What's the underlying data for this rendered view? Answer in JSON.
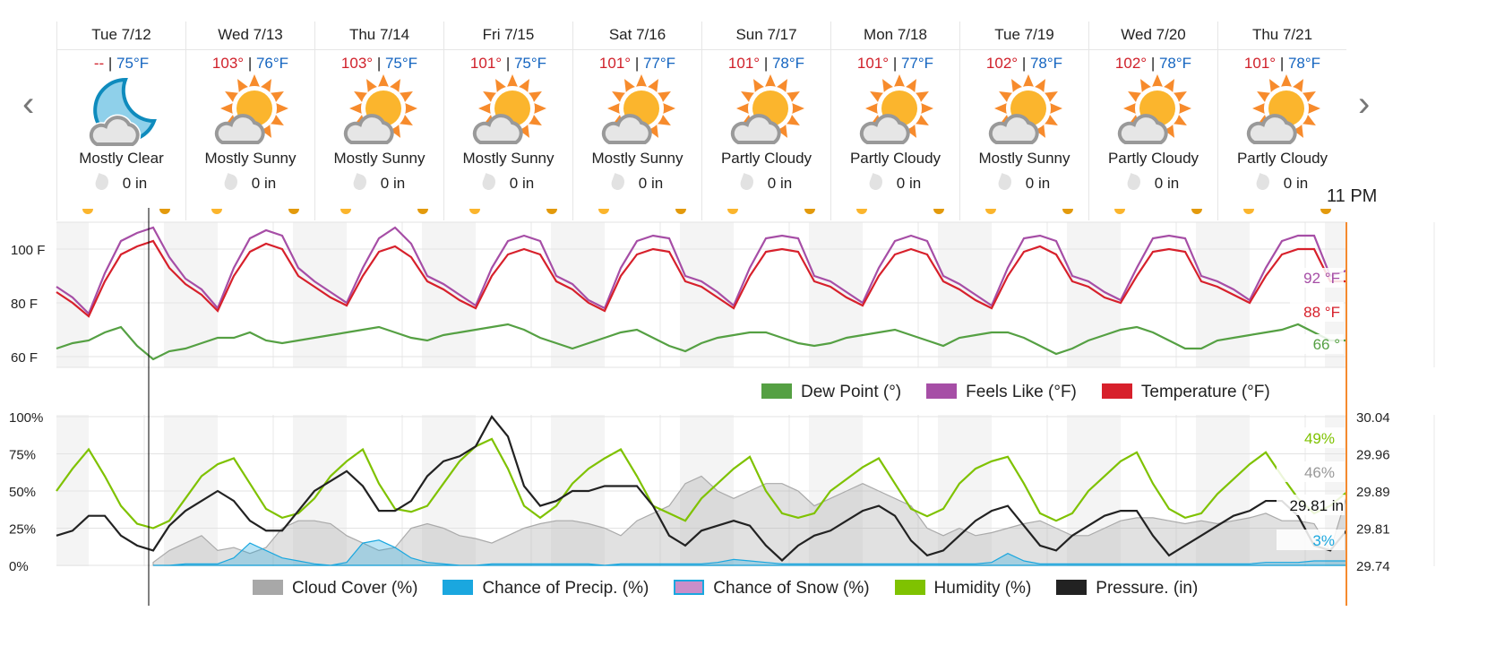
{
  "nav": {
    "prev_icon": "chevron-left-icon",
    "next_icon": "chevron-right-icon",
    "prev": "‹",
    "next": "›"
  },
  "current_time_label": "11 PM",
  "days": [
    {
      "date": "Tue 7/12",
      "high": "--",
      "low": "75°F",
      "icon": "moon-cloud-icon",
      "condition": "Mostly Clear",
      "precip": "0 in"
    },
    {
      "date": "Wed 7/13",
      "high": "103°",
      "low": "76°F",
      "icon": "sun-cloud-icon",
      "condition": "Mostly Sunny",
      "precip": "0 in"
    },
    {
      "date": "Thu 7/14",
      "high": "103°",
      "low": "75°F",
      "icon": "sun-cloud-icon",
      "condition": "Mostly Sunny",
      "precip": "0 in"
    },
    {
      "date": "Fri 7/15",
      "high": "101°",
      "low": "75°F",
      "icon": "sun-cloud-icon",
      "condition": "Mostly Sunny",
      "precip": "0 in"
    },
    {
      "date": "Sat 7/16",
      "high": "101°",
      "low": "77°F",
      "icon": "sun-cloud-icon",
      "condition": "Mostly Sunny",
      "precip": "0 in"
    },
    {
      "date": "Sun 7/17",
      "high": "101°",
      "low": "78°F",
      "icon": "sun-cloud-icon",
      "condition": "Partly Cloudy",
      "precip": "0 in"
    },
    {
      "date": "Mon 7/18",
      "high": "101°",
      "low": "77°F",
      "icon": "sun-cloud-icon",
      "condition": "Partly Cloudy",
      "precip": "0 in"
    },
    {
      "date": "Tue 7/19",
      "high": "102°",
      "low": "78°F",
      "icon": "sun-cloud-icon",
      "condition": "Mostly Sunny",
      "precip": "0 in"
    },
    {
      "date": "Wed 7/20",
      "high": "102°",
      "low": "78°F",
      "icon": "sun-cloud-icon",
      "condition": "Partly Cloudy",
      "precip": "0 in"
    },
    {
      "date": "Thu 7/21",
      "high": "101°",
      "low": "78°F",
      "icon": "sun-cloud-icon",
      "condition": "Partly Cloudy",
      "precip": "0 in"
    }
  ],
  "colors": {
    "temperature": "#d7202b",
    "feels_like": "#a64ea6",
    "dew_point": "#55a043",
    "humidity": "#7fc200",
    "cloud": "#a8a8a8",
    "precip": "#1aa7df",
    "snow": "#c98ec9",
    "pressure": "#222222",
    "now_line": "#000000",
    "end_line": "#f58a2e"
  },
  "chart_data": [
    {
      "type": "line",
      "x_unit": "hours from Tue 7/12 00:00 (every 3 h)",
      "yticks": [
        "60 F",
        "80 F",
        "100 F"
      ],
      "ylim": [
        56,
        110
      ],
      "series": [
        {
          "name": "Temperature (°F)",
          "values": [
            84,
            80,
            75,
            88,
            98,
            101,
            103,
            93,
            87,
            83,
            77,
            90,
            99,
            102,
            100,
            90,
            86,
            82,
            79,
            90,
            99,
            101,
            97,
            88,
            85,
            81,
            78,
            90,
            98,
            100,
            98,
            88,
            85,
            80,
            77,
            90,
            98,
            100,
            99,
            88,
            86,
            82,
            78,
            90,
            99,
            100,
            99,
            88,
            86,
            82,
            79,
            90,
            98,
            100,
            98,
            88,
            85,
            81,
            78,
            90,
            99,
            101,
            98,
            88,
            86,
            82,
            80,
            90,
            99,
            100,
            99,
            88,
            86,
            83,
            80,
            90,
            98,
            100,
            100,
            88,
            88
          ]
        },
        {
          "name": "Feels Like (°F)",
          "values": [
            86,
            82,
            76,
            91,
            103,
            106,
            108,
            97,
            89,
            85,
            78,
            93,
            104,
            107,
            105,
            93,
            88,
            84,
            80,
            93,
            104,
            108,
            102,
            90,
            87,
            83,
            79,
            93,
            103,
            105,
            103,
            90,
            87,
            81,
            78,
            93,
            103,
            105,
            104,
            90,
            88,
            84,
            79,
            93,
            104,
            105,
            104,
            90,
            88,
            84,
            80,
            93,
            103,
            105,
            103,
            90,
            87,
            83,
            79,
            93,
            104,
            105,
            103,
            90,
            88,
            84,
            81,
            93,
            104,
            105,
            104,
            90,
            88,
            85,
            81,
            93,
            103,
            105,
            105,
            90,
            92
          ]
        },
        {
          "name": "Dew Point (°)",
          "values": [
            63,
            65,
            66,
            69,
            71,
            64,
            59,
            62,
            63,
            65,
            67,
            67,
            69,
            66,
            65,
            66,
            67,
            68,
            69,
            70,
            71,
            69,
            67,
            66,
            68,
            69,
            70,
            71,
            72,
            70,
            67,
            65,
            63,
            65,
            67,
            69,
            70,
            67,
            64,
            62,
            65,
            67,
            68,
            69,
            69,
            67,
            65,
            64,
            65,
            67,
            68,
            69,
            70,
            68,
            66,
            64,
            67,
            68,
            69,
            69,
            67,
            64,
            61,
            63,
            66,
            68,
            70,
            71,
            69,
            66,
            63,
            63,
            66,
            67,
            68,
            69,
            70,
            72,
            69,
            66,
            66
          ]
        }
      ],
      "end_labels": [
        "92 °F",
        "88 °F",
        "66 °"
      ],
      "legend": [
        "Dew Point (°)",
        "Feels Like (°F)",
        "Temperature (°F)"
      ]
    },
    {
      "type": "area",
      "yticks_left": [
        "0%",
        "25%",
        "50%",
        "75%",
        "100%"
      ],
      "yticks_right": [
        "29.74",
        "29.81",
        "29.89",
        "29.96",
        "30.04"
      ],
      "ylim": [
        0,
        100
      ],
      "ylim_right": [
        29.74,
        30.04
      ],
      "series": [
        {
          "name": "Cloud Cover (%)",
          "values": [
            null,
            null,
            null,
            null,
            null,
            null,
            2,
            10,
            15,
            20,
            10,
            12,
            8,
            12,
            25,
            30,
            30,
            28,
            20,
            15,
            10,
            12,
            25,
            28,
            25,
            20,
            18,
            15,
            20,
            25,
            28,
            30,
            30,
            28,
            25,
            20,
            30,
            35,
            40,
            55,
            60,
            50,
            45,
            50,
            55,
            55,
            50,
            40,
            45,
            50,
            55,
            50,
            45,
            40,
            25,
            20,
            25,
            20,
            22,
            25,
            28,
            30,
            25,
            20,
            20,
            25,
            30,
            32,
            32,
            30,
            28,
            30,
            28,
            30,
            32,
            35,
            30,
            30,
            28,
            10,
            46
          ]
        },
        {
          "name": "Chance of Precip. (%)",
          "values": [
            null,
            null,
            null,
            null,
            null,
            null,
            0,
            0,
            1,
            1,
            1,
            5,
            15,
            10,
            5,
            3,
            1,
            0,
            2,
            15,
            17,
            12,
            5,
            2,
            1,
            0,
            0,
            1,
            1,
            1,
            1,
            1,
            1,
            1,
            0,
            1,
            1,
            1,
            1,
            1,
            1,
            2,
            4,
            3,
            2,
            1,
            1,
            1,
            1,
            1,
            1,
            1,
            1,
            1,
            1,
            1,
            1,
            1,
            2,
            8,
            3,
            1,
            1,
            1,
            1,
            1,
            1,
            1,
            1,
            1,
            1,
            1,
            1,
            1,
            1,
            2,
            2,
            2,
            3,
            3,
            3
          ]
        },
        {
          "name": "Chance of Snow (%)",
          "values": []
        },
        {
          "name": "Humidity (%)",
          "values": [
            50,
            65,
            78,
            60,
            40,
            28,
            25,
            30,
            45,
            60,
            68,
            72,
            55,
            38,
            32,
            35,
            45,
            60,
            70,
            78,
            55,
            38,
            36,
            40,
            55,
            70,
            80,
            85,
            65,
            40,
            32,
            40,
            55,
            65,
            72,
            78,
            60,
            40,
            35,
            30,
            45,
            55,
            65,
            73,
            50,
            35,
            32,
            35,
            50,
            58,
            66,
            72,
            55,
            38,
            33,
            38,
            55,
            65,
            70,
            73,
            55,
            35,
            30,
            35,
            50,
            60,
            70,
            76,
            55,
            38,
            32,
            35,
            48,
            58,
            68,
            76,
            60,
            45,
            35,
            40,
            49
          ]
        },
        {
          "name": "Pressure. (in)",
          "axis": "right",
          "values": [
            29.8,
            29.81,
            29.84,
            29.84,
            29.8,
            29.78,
            29.77,
            29.82,
            29.85,
            29.87,
            29.89,
            29.87,
            29.83,
            29.81,
            29.81,
            29.85,
            29.89,
            29.91,
            29.93,
            29.9,
            29.85,
            29.85,
            29.87,
            29.92,
            29.95,
            29.96,
            29.98,
            30.04,
            30.0,
            29.9,
            29.86,
            29.87,
            29.89,
            29.89,
            29.9,
            29.9,
            29.9,
            29.86,
            29.8,
            29.78,
            29.81,
            29.82,
            29.83,
            29.82,
            29.78,
            29.75,
            29.78,
            29.8,
            29.81,
            29.83,
            29.85,
            29.86,
            29.84,
            29.79,
            29.76,
            29.77,
            29.8,
            29.83,
            29.85,
            29.86,
            29.82,
            29.78,
            29.77,
            29.8,
            29.82,
            29.84,
            29.85,
            29.85,
            29.8,
            29.76,
            29.78,
            29.8,
            29.82,
            29.84,
            29.85,
            29.87,
            29.87,
            29.84,
            29.78,
            29.77,
            29.81
          ]
        }
      ],
      "end_labels": [
        "49%",
        "46%",
        "29.81 in",
        "3%"
      ],
      "legend": [
        "Cloud Cover (%)",
        "Chance of Precip. (%)",
        "Chance of Snow (%)",
        "Humidity (%)",
        "Pressure. (in)"
      ]
    }
  ]
}
